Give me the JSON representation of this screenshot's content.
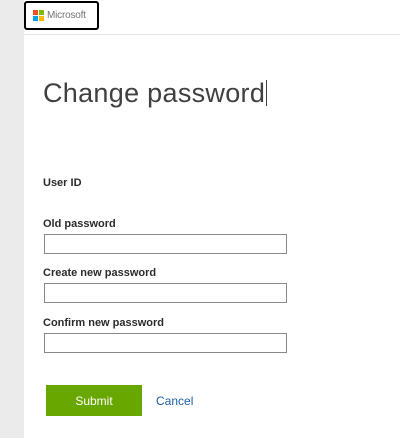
{
  "header": {
    "logo_text": "Microsoft",
    "logo_colors": [
      "#f25022",
      "#7fba00",
      "#00a4ef",
      "#ffb900"
    ]
  },
  "form": {
    "title": "Change password",
    "user_id_label": "User ID",
    "old_password_label": "Old password",
    "old_password_value": "",
    "new_password_label": "Create new password",
    "new_password_value": "",
    "confirm_password_label": "Confirm new password",
    "confirm_password_value": ""
  },
  "actions": {
    "submit_label": "Submit",
    "cancel_label": "Cancel",
    "submit_color": "#68a600",
    "cancel_color": "#1e5fa8"
  }
}
